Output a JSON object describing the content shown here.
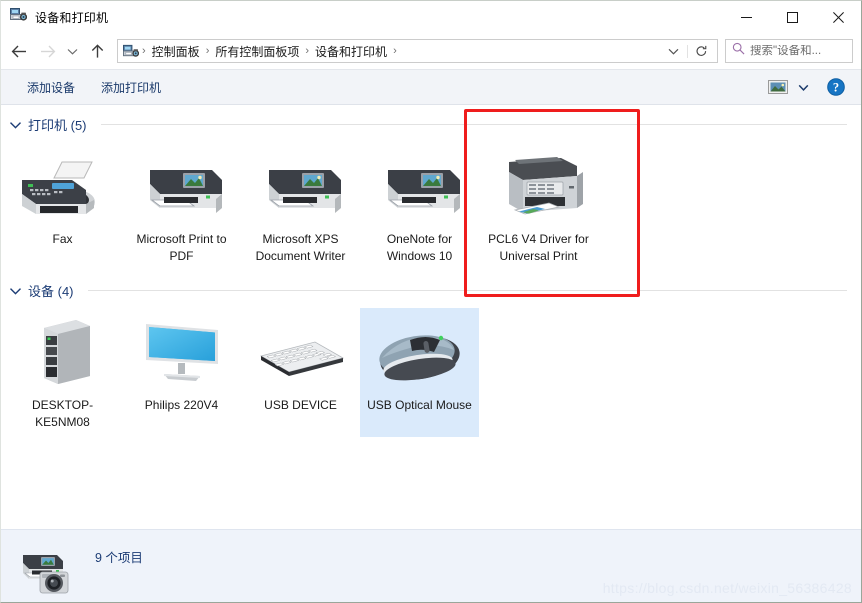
{
  "window": {
    "title": "设备和打印机",
    "icon": "devices-printers-icon",
    "controls": {
      "minimize": "minimize-icon",
      "maximize": "maximize-icon",
      "close": "close-icon"
    }
  },
  "address_bar": {
    "back": "back-arrow-icon",
    "forward": "forward-arrow-icon",
    "recent": "chevron-down-icon",
    "up": "up-arrow-icon",
    "crumb_icon": "devices-printers-icon",
    "crumbs": [
      "控制面板",
      "所有控制面板项",
      "设备和打印机"
    ],
    "separator": "›",
    "dropdown": "chevron-down-icon",
    "refresh": "refresh-icon"
  },
  "search": {
    "icon": "search-icon",
    "placeholder": "搜索\"设备和...",
    "value": ""
  },
  "command_bar": {
    "add_device": "添加设备",
    "add_printer": "添加打印机",
    "view_icon": "preview-pane-icon",
    "view_dropdown": "chevron-down-icon",
    "help_icon": "help-icon"
  },
  "groups": [
    {
      "id": "printers",
      "chevron": "chevron-down-icon",
      "title": "打印机 (5)",
      "items": [
        {
          "label": "Fax",
          "icon": "fax-machine-icon",
          "selected": false
        },
        {
          "label": "Microsoft Print to PDF",
          "icon": "printer-icon",
          "selected": false
        },
        {
          "label": "Microsoft XPS Document Writer",
          "icon": "printer-icon",
          "selected": false
        },
        {
          "label": "OneNote for Windows 10",
          "icon": "printer-icon",
          "selected": false
        },
        {
          "label": "PCL6 V4 Driver for Universal Print",
          "icon": "multifunction-printer-icon",
          "selected": false,
          "highlighted": true
        }
      ]
    },
    {
      "id": "devices",
      "chevron": "chevron-down-icon",
      "title": "设备 (4)",
      "items": [
        {
          "label": "DESKTOP-KE5NM08",
          "icon": "desktop-tower-icon",
          "selected": false
        },
        {
          "label": "Philips 220V4",
          "icon": "monitor-icon",
          "selected": false
        },
        {
          "label": "USB DEVICE",
          "icon": "keyboard-icon",
          "selected": false
        },
        {
          "label": "USB Optical Mouse",
          "icon": "mouse-icon",
          "selected": true
        }
      ]
    }
  ],
  "status_bar": {
    "icon": "printer-camera-icon",
    "text": "9 个项目"
  },
  "watermark": "https://blog.csdn.net/weixin_56386428",
  "colors": {
    "accent_blue": "#1c3c75",
    "selection": "#daeafb",
    "highlight_red": "#ef1d1d",
    "command_bar_bg": "#f2f4f8",
    "status_bar_bg": "#eff3fa"
  }
}
